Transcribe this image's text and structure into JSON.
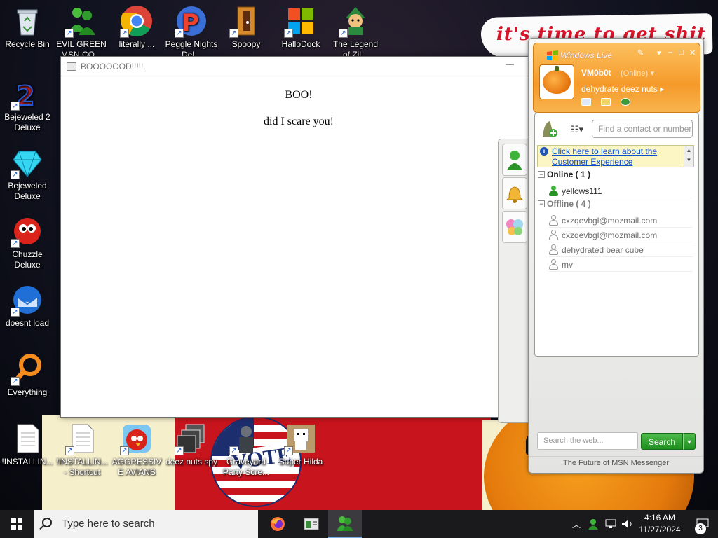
{
  "desktop": {
    "wallpaper_text": "it's time to get shit",
    "vote_text": "VOTE",
    "icons": [
      {
        "label": "Recycle Bin"
      },
      {
        "label": "EVIL GREEN MSN CO..."
      },
      {
        "label": "literally ..."
      },
      {
        "label": "Peggle Nights Del..."
      },
      {
        "label": "Spoopy"
      },
      {
        "label": "HalloDock"
      },
      {
        "label": "The Legend of Zil..."
      },
      {
        "label": "Bejeweled 2 Deluxe"
      },
      {
        "label": "Bejeweled Deluxe"
      },
      {
        "label": "Chuzzle Deluxe"
      },
      {
        "label": "doesnt load"
      },
      {
        "label": "Everything"
      },
      {
        "label": "!INSTALLIN..."
      },
      {
        "label": "!INSTALLIN... - Shortcut"
      },
      {
        "label": "AGGRESSIVE AVIANS"
      },
      {
        "label": "deez nuts spy"
      },
      {
        "label": "Graveyard Party Scre..."
      },
      {
        "label": "Super Hilda"
      }
    ]
  },
  "boo_window": {
    "title": "BOOOOOOD!!!!!",
    "heading": "BOO!",
    "text": "did I scare you!"
  },
  "msn": {
    "title": "Windows Live",
    "username": "VM0b0t",
    "status": "(Online)",
    "personal_message": "dehydrate deez nuts",
    "find_placeholder": "Find a contact or number...",
    "info_link": "Click here to learn about the Customer Experience",
    "groups": {
      "online_label": "Online ( 1 )",
      "offline_label": "Offline ( 4 )"
    },
    "online_contacts": [
      "yellows111"
    ],
    "offline_contacts": [
      "cxzqevbgl@mozmail.com",
      "cxzqevbgl@mozmail.com",
      "dehydrated bear cube",
      "mv"
    ],
    "search_placeholder": "Search the web...",
    "search_button": "Search",
    "footer": "The Future of MSN Messenger",
    "colors": {
      "header_orange": "#f59a2a",
      "online_green": "#35a534",
      "offline_gray": "#9a9a9a"
    }
  },
  "taskbar": {
    "search_placeholder": "Type here to search",
    "time": "4:16 AM",
    "date": "11/27/2024",
    "notification_count": "3",
    "apps": [
      "firefox-icon",
      "file-explorer-icon",
      "msn-messenger-icon"
    ]
  }
}
